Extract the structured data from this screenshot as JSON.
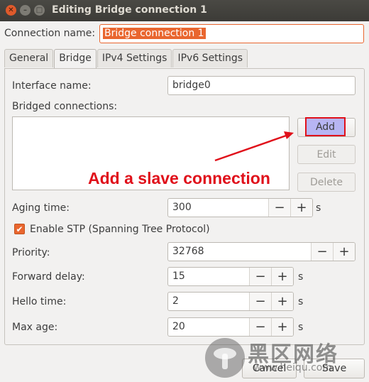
{
  "window": {
    "title": "Editing Bridge connection 1",
    "controls": [
      "close-icon",
      "minimize-icon",
      "maximize-icon"
    ]
  },
  "connection_name": {
    "label": "Connection name:",
    "value": "Bridge connection 1"
  },
  "tabs": [
    {
      "label": "General"
    },
    {
      "label": "Bridge",
      "active": true
    },
    {
      "label": "IPv4 Settings"
    },
    {
      "label": "IPv6 Settings"
    }
  ],
  "bridge": {
    "interface_name": {
      "label": "Interface name:",
      "value": "bridge0"
    },
    "bridged_connections": {
      "label": "Bridged connections:"
    },
    "buttons": {
      "add": "Add",
      "edit": "Edit",
      "delete": "Delete"
    },
    "aging_time": {
      "label": "Aging time:",
      "value": "300",
      "unit": "s"
    },
    "enable_stp": {
      "label": "Enable STP (Spanning Tree Protocol)",
      "checked": true
    },
    "priority": {
      "label": "Priority:",
      "value": "32768"
    },
    "forward_delay": {
      "label": "Forward delay:",
      "value": "15",
      "unit": "s"
    },
    "hello_time": {
      "label": "Hello time:",
      "value": "2",
      "unit": "s"
    },
    "max_age": {
      "label": "Max age:",
      "value": "20",
      "unit": "s"
    }
  },
  "spin": {
    "minus": "−",
    "plus": "+"
  },
  "annotation": {
    "text": "Add a slave connection",
    "color": "#e0101a"
  },
  "footer": {
    "cancel": "Cancel",
    "save": "Save"
  },
  "watermark": {
    "text": "黑区网络",
    "url": "www.heiqu.com"
  },
  "colors": {
    "accent": "#e9662f",
    "titlebar": "#3c3b37",
    "highlight": "#e0101a"
  }
}
